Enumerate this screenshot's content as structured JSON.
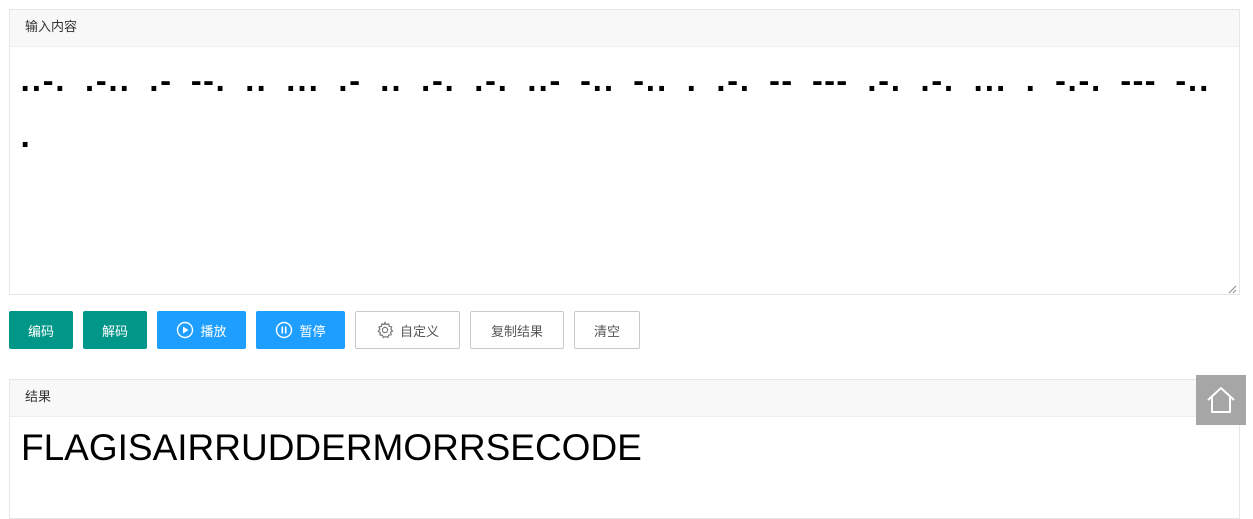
{
  "input_panel": {
    "header": "输入内容",
    "content": "..-. .-.. .- --. .. ... .- .. .-. .-. ..- -.. -.. . .-. -- --- .-. .-. ... . -.-. --- -.. ."
  },
  "toolbar": {
    "encode_label": "编码",
    "decode_label": "解码",
    "play_label": "播放",
    "pause_label": "暂停",
    "custom_label": "自定义",
    "copy_label": "复制结果",
    "clear_label": "清空"
  },
  "result_panel": {
    "header": "结果",
    "content": "FLAGISAIRRUDDERMORRSECODE"
  },
  "icons": {
    "play": "play-circle-icon",
    "pause": "pause-circle-icon",
    "custom": "gear-icon",
    "home": "home-icon"
  },
  "colors": {
    "green": "#009688",
    "blue": "#1e9fff",
    "home_bg": "#a6a6a6"
  }
}
